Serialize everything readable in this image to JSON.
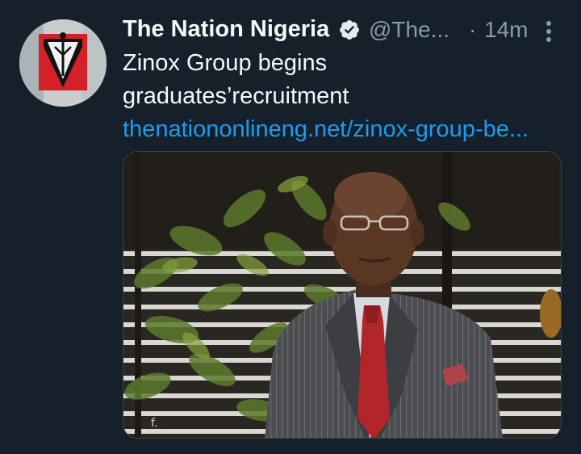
{
  "tweet": {
    "display_name": "The Nation Nigeria",
    "handle": "@The...",
    "separator": "·",
    "time": "14m",
    "text_line1": "Zinox Group begins",
    "text_line2": "graduates’recruitment",
    "link_text": "thenationonlineng.net/zinox-group-be...",
    "avatar_icon": "the-nation-logo-icon",
    "verified_icon": "verified-badge-icon",
    "more_icon": "more-options-icon",
    "media_description_icon": "photo-icon"
  },
  "colors": {
    "background": "#15202b",
    "text_primary": "#f7f9f9",
    "text_secondary": "#8b98a5",
    "link": "#1d9bf0",
    "logo_red": "#d42027"
  }
}
